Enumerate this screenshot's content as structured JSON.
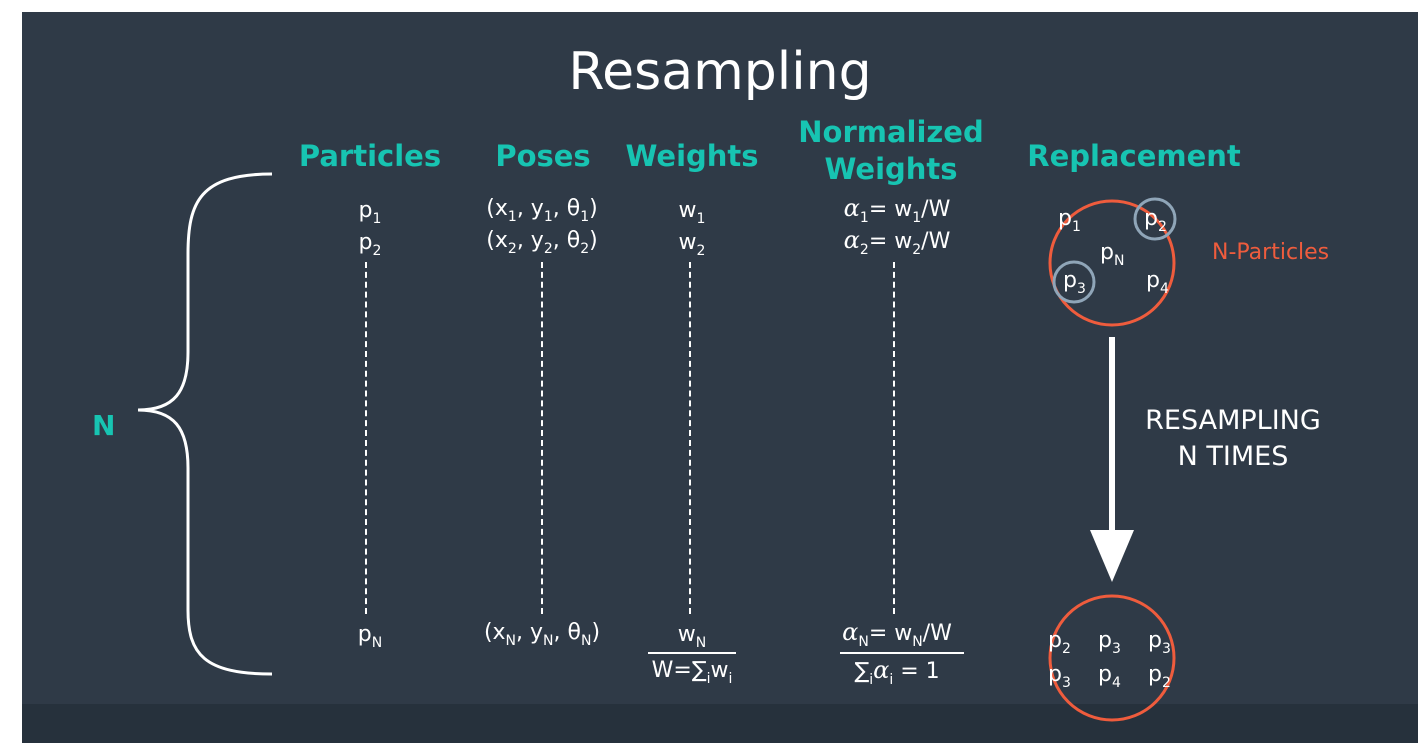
{
  "title": "Resampling",
  "headers": {
    "particles": "Particles",
    "poses": "Poses",
    "weights": "Weights",
    "normalized_line1": "Normalized",
    "normalized_line2": "Weights",
    "replacement": "Replacement"
  },
  "brace_label": "N",
  "particles": {
    "first": "p",
    "first_sub": "1",
    "second": "p",
    "second_sub": "2",
    "last": "p",
    "last_sub": "N"
  },
  "poses": {
    "first": {
      "open": "(x",
      "s1": "1",
      "m1": ", y",
      "s2": "1",
      "m2": ", θ",
      "s3": "1",
      "close": ")"
    },
    "second": {
      "open": "(x",
      "s1": "2",
      "m1": ", y",
      "s2": "2",
      "m2": ", θ",
      "s3": "2",
      "close": ")"
    },
    "last": {
      "open": "(x",
      "s1": "N",
      "m1": ", y",
      "s2": "N",
      "m2": ", θ",
      "s3": "N",
      "close": ")"
    }
  },
  "weights": {
    "first": "w",
    "first_sub": "1",
    "second": "w",
    "second_sub": "2",
    "last": "w",
    "last_sub": "N",
    "sum_a": "W=∑",
    "sum_sub1": "i",
    "sum_b": "w",
    "sum_sub2": "i"
  },
  "normalized": {
    "alpha": "α",
    "first": {
      "sub": "1",
      "eq": "= w",
      "wsub": "1",
      "tail": "/W"
    },
    "second": {
      "sub": "2",
      "eq": "= w",
      "wsub": "2",
      "tail": "/W"
    },
    "last": {
      "sub": "N",
      "eq": "= w",
      "wsub": "N",
      "tail": "/W"
    },
    "sum": {
      "sigma": "∑",
      "sigma_sub": "i",
      "alpha_sub": "i",
      "tail": " = 1"
    }
  },
  "replacement": {
    "top_particles": [
      {
        "p": "p",
        "sub": "1",
        "circled": false
      },
      {
        "p": "p",
        "sub": "2",
        "circled": true
      },
      {
        "p": "p",
        "sub": "N",
        "circled": false
      },
      {
        "p": "p",
        "sub": "3",
        "circled": true
      },
      {
        "p": "p",
        "sub": "4",
        "circled": false
      }
    ],
    "n_particles_label": "N-Particles",
    "resampling_line1": "RESAMPLING",
    "resampling_line2": "N TIMES",
    "bottom_particles": [
      {
        "p": "p",
        "sub": "2"
      },
      {
        "p": "p",
        "sub": "3"
      },
      {
        "p": "p",
        "sub": "3"
      },
      {
        "p": "p",
        "sub": "3"
      },
      {
        "p": "p",
        "sub": "4"
      },
      {
        "p": "p",
        "sub": "2"
      }
    ]
  },
  "colors": {
    "background": "#2f3a47",
    "header_teal": "#17c4b2",
    "accent_orange": "#ef5c3d",
    "ring_gray": "#8fa5b8",
    "text": "#ffffff"
  }
}
